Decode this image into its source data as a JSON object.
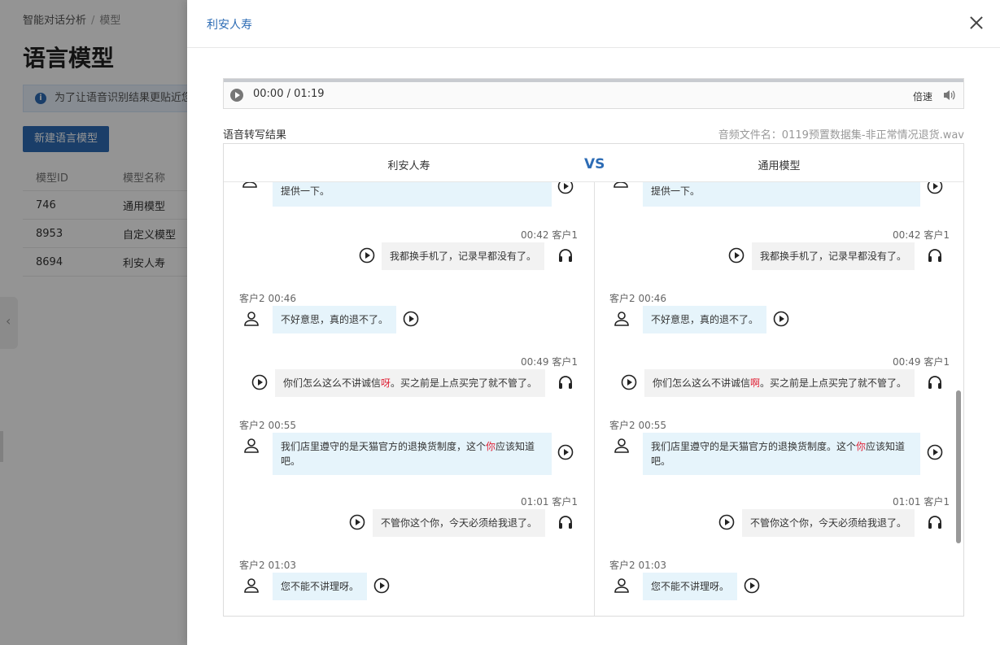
{
  "background": {
    "breadcrumb": [
      "智能对话分析",
      "/",
      "模型"
    ],
    "title": "语言模型",
    "notice": "为了让语音识别结果更贴近您的",
    "new_button": "新建语言模型",
    "table": {
      "headers": [
        "模型ID",
        "模型名称"
      ],
      "rows": [
        {
          "id": "746",
          "name": "通用模型"
        },
        {
          "id": "8953",
          "name": "自定义模型"
        },
        {
          "id": "8694",
          "name": "利安人寿"
        }
      ]
    }
  },
  "drawer": {
    "title": "利安人寿",
    "player": {
      "time": "00:00 / 01:19",
      "speed": "倍速"
    },
    "result_label": "语音转写结果",
    "file_name": "音频文件名：0119预置数据集-非正常情况退货.wav",
    "compare": {
      "left_title": "利安人寿",
      "vs": "VS",
      "right_title": "通用模型",
      "left": {
        "m0": "提供一下。",
        "m1_meta": "00:42 客户1",
        "m1": "我都换手机了，记录早都没有了。",
        "m2_meta": "客户2 00:46",
        "m2": "不好意思，真的退不了。",
        "m3_meta": "00:49 客户1",
        "m3_a": "你们怎么这么不讲诚信",
        "m3_hl": "呀",
        "m3_b": "。买之前是上点买完了就不管了。",
        "m4_meta": "客户2 00:55",
        "m4_a": "我们店里遵守的是天猫官方的退换货制度，这个",
        "m4_hl": "你",
        "m4_b": "应该知道吧。",
        "m5_meta": "01:01 客户1",
        "m5": "不管你这个你，今天必须给我退了。",
        "m6_meta": "客户2 01:03",
        "m6": "您不能不讲理呀。"
      },
      "right": {
        "m0": "提供一下。",
        "m1_meta": "00:42 客户1",
        "m1": "我都换手机了，记录早都没有了。",
        "m2_meta": "客户2 00:46",
        "m2": "不好意思，真的退不了。",
        "m3_meta": "00:49 客户1",
        "m3_a": "你们怎么这么不讲诚信",
        "m3_hl": "啊",
        "m3_b": "。买之前是上点买完了就不管了。",
        "m4_meta": "客户2 00:55",
        "m4_a": "我们店里遵守的是天猫官方的退换货制度。这个",
        "m4_hl": "你",
        "m4_b": "应该知道吧。",
        "m5_meta": "01:01 客户1",
        "m5": "不管你这个你，今天必须给我退了。",
        "m6_meta": "客户2 01:03",
        "m6": "您不能不讲理呀。"
      }
    }
  },
  "colors": {
    "accent": "#2d6cb5",
    "highlight": "#e0263a",
    "customer2_bubble": "#e6f4fb",
    "customer1_bubble": "#f2f2f2"
  },
  "icons": [
    "play-icon",
    "headset-icon",
    "user-icon",
    "volume-icon",
    "close-icon",
    "info-icon"
  ]
}
